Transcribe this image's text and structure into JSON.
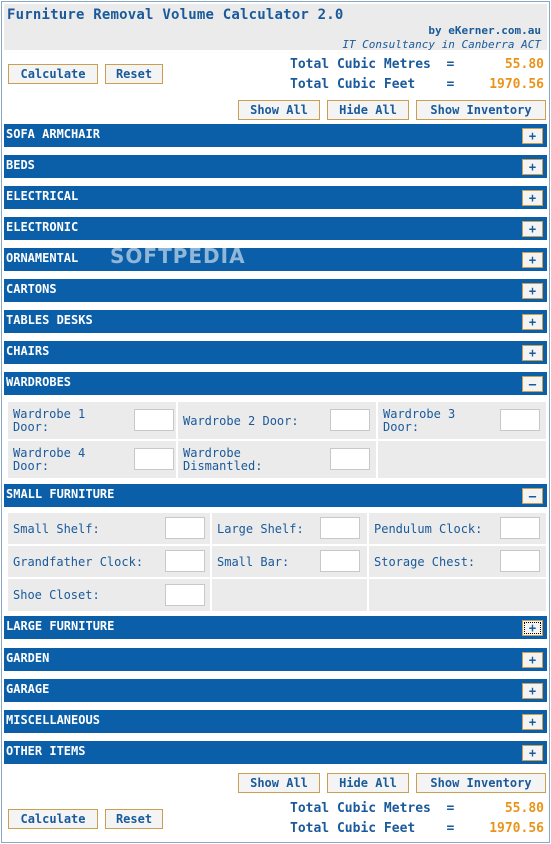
{
  "header": {
    "title": "Furniture Removal Volume Calculator 2.0",
    "byline": "by eKerner.com.au",
    "tagline": "IT Consultancy in Canberra ACT"
  },
  "actions": {
    "calculate": "Calculate",
    "reset": "Reset",
    "show_all": "Show All",
    "hide_all": "Hide All",
    "show_inventory": "Show Inventory"
  },
  "totals": {
    "metres_label": "Total Cubic Metres  =",
    "metres_value": "55.80",
    "feet_label": "Total Cubic Feet    =",
    "feet_value": "1970.56"
  },
  "sections": [
    {
      "label": "SOFA ARMCHAIR",
      "toggle": "+"
    },
    {
      "label": "BEDS",
      "toggle": "+"
    },
    {
      "label": "ELECTRICAL",
      "toggle": "+"
    },
    {
      "label": "ELECTRONIC",
      "toggle": "+"
    },
    {
      "label": "ORNAMENTAL",
      "toggle": "+"
    },
    {
      "label": "CARTONS",
      "toggle": "+"
    },
    {
      "label": "TABLES DESKS",
      "toggle": "+"
    },
    {
      "label": "CHAIRS",
      "toggle": "+"
    },
    {
      "label": "WARDROBES",
      "toggle": "–"
    },
    {
      "label": "SMALL FURNITURE",
      "toggle": "–"
    },
    {
      "label": "LARGE FURNITURE",
      "toggle": "+"
    },
    {
      "label": "GARDEN",
      "toggle": "+"
    },
    {
      "label": "GARAGE",
      "toggle": "+"
    },
    {
      "label": "MISCELLANEOUS",
      "toggle": "+"
    },
    {
      "label": "OTHER ITEMS",
      "toggle": "+"
    }
  ],
  "wardrobes": {
    "items": [
      "Wardrobe 1 Door:",
      "Wardrobe 2 Door:",
      "Wardrobe 3 Door:",
      "Wardrobe 4 Door:",
      "Wardrobe Dismantled:"
    ],
    "values": [
      "",
      "",
      "",
      "",
      ""
    ]
  },
  "small_furniture": {
    "items": [
      "Small Shelf:",
      "Large Shelf:",
      "Pendulum Clock:",
      "Grandfather Clock:",
      "Small Bar:",
      "Storage Chest:",
      "Shoe Closet:"
    ],
    "values": [
      "",
      "",
      "",
      "",
      "",
      "",
      ""
    ]
  },
  "watermark": "SOFTPEDIA",
  "colors": {
    "section_bar": "#0b5ea8",
    "accent_value": "#e8941a",
    "text_blue": "#1a5a9a",
    "cell_bg": "#ebebeb",
    "button_border": "#c9a050"
  }
}
